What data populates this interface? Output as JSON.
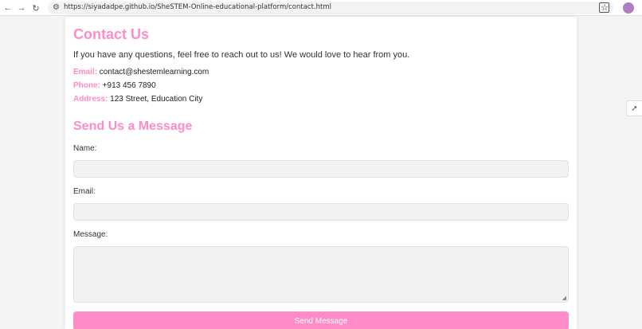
{
  "browser": {
    "back_icon": "←",
    "forward_icon": "→",
    "reload_icon": "↻",
    "site_settings_icon": "⚙",
    "url": "https://siyadadpe.github.io/SheSTEM-Online-educational-platform/contact.html",
    "star_icon": "☆"
  },
  "page": {
    "title": "Contact Us",
    "intro": "If you have any questions, feel free to reach out to us! We would love to hear from you.",
    "contact": {
      "email_label": "Email:",
      "email_value": "contact@shestemlearning.com",
      "phone_label": "Phone:",
      "phone_value": "+913 456 7890",
      "address_label": "Address:",
      "address_value": "123 Street, Education City"
    },
    "form": {
      "heading": "Send Us a Message",
      "name_label": "Name:",
      "email_label": "Email:",
      "message_label": "Message:",
      "submit_label": "Send Message"
    }
  },
  "colors": {
    "accent": "#ff8cc6",
    "field_bg": "#f2f2f2"
  }
}
